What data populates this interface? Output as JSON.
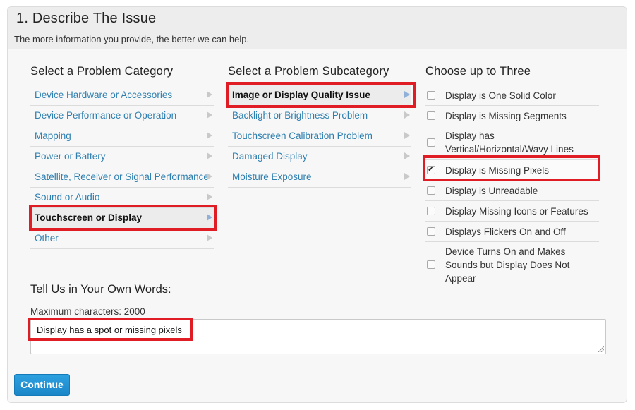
{
  "section": {
    "title": "1. Describe The Issue",
    "subtitle": "The more information you provide, the better we can help."
  },
  "categories": {
    "heading": "Select a Problem Category",
    "items": [
      {
        "label": "Device Hardware or Accessories",
        "selected": false
      },
      {
        "label": "Device Performance or Operation",
        "selected": false
      },
      {
        "label": "Mapping",
        "selected": false
      },
      {
        "label": "Power or Battery",
        "selected": false
      },
      {
        "label": "Satellite, Receiver or Signal Performance",
        "selected": false
      },
      {
        "label": "Sound or Audio",
        "selected": false
      },
      {
        "label": "Touchscreen or Display",
        "selected": true
      },
      {
        "label": "Other",
        "selected": false
      }
    ]
  },
  "subcategories": {
    "heading": "Select a Problem Subcategory",
    "items": [
      {
        "label": "Image or Display Quality Issue",
        "selected": true
      },
      {
        "label": "Backlight or Brightness Problem",
        "selected": false
      },
      {
        "label": "Touchscreen Calibration Problem",
        "selected": false
      },
      {
        "label": "Damaged Display",
        "selected": false
      },
      {
        "label": "Moisture Exposure",
        "selected": false
      }
    ]
  },
  "choices": {
    "heading": "Choose up to Three",
    "items": [
      {
        "label": "Display is One Solid Color",
        "checked": false
      },
      {
        "label": "Display is Missing Segments",
        "checked": false
      },
      {
        "label": "Display has",
        "label_line2": "Vertical/Horizontal/Wavy Lines",
        "checked": false
      },
      {
        "label": "Display is Missing Pixels",
        "checked": true
      },
      {
        "label": "Display is Unreadable",
        "checked": false
      },
      {
        "label": "Display Missing Icons or Features",
        "checked": false
      },
      {
        "label": "Displays Flickers On and Off",
        "checked": false
      },
      {
        "label": "Device Turns On and Makes",
        "label_line2": "Sounds but Display Does Not",
        "label_line3": "Appear",
        "checked": false
      }
    ]
  },
  "own_words": {
    "heading": "Tell Us in Your Own Words:",
    "max_chars": "Maximum characters: 2000",
    "value": "Display has a spot or missing pixels"
  },
  "actions": {
    "continue_label": "Continue"
  },
  "colors": {
    "link": "#2e7fb0",
    "highlight": "#e01c24",
    "button": "#1a86c8"
  }
}
